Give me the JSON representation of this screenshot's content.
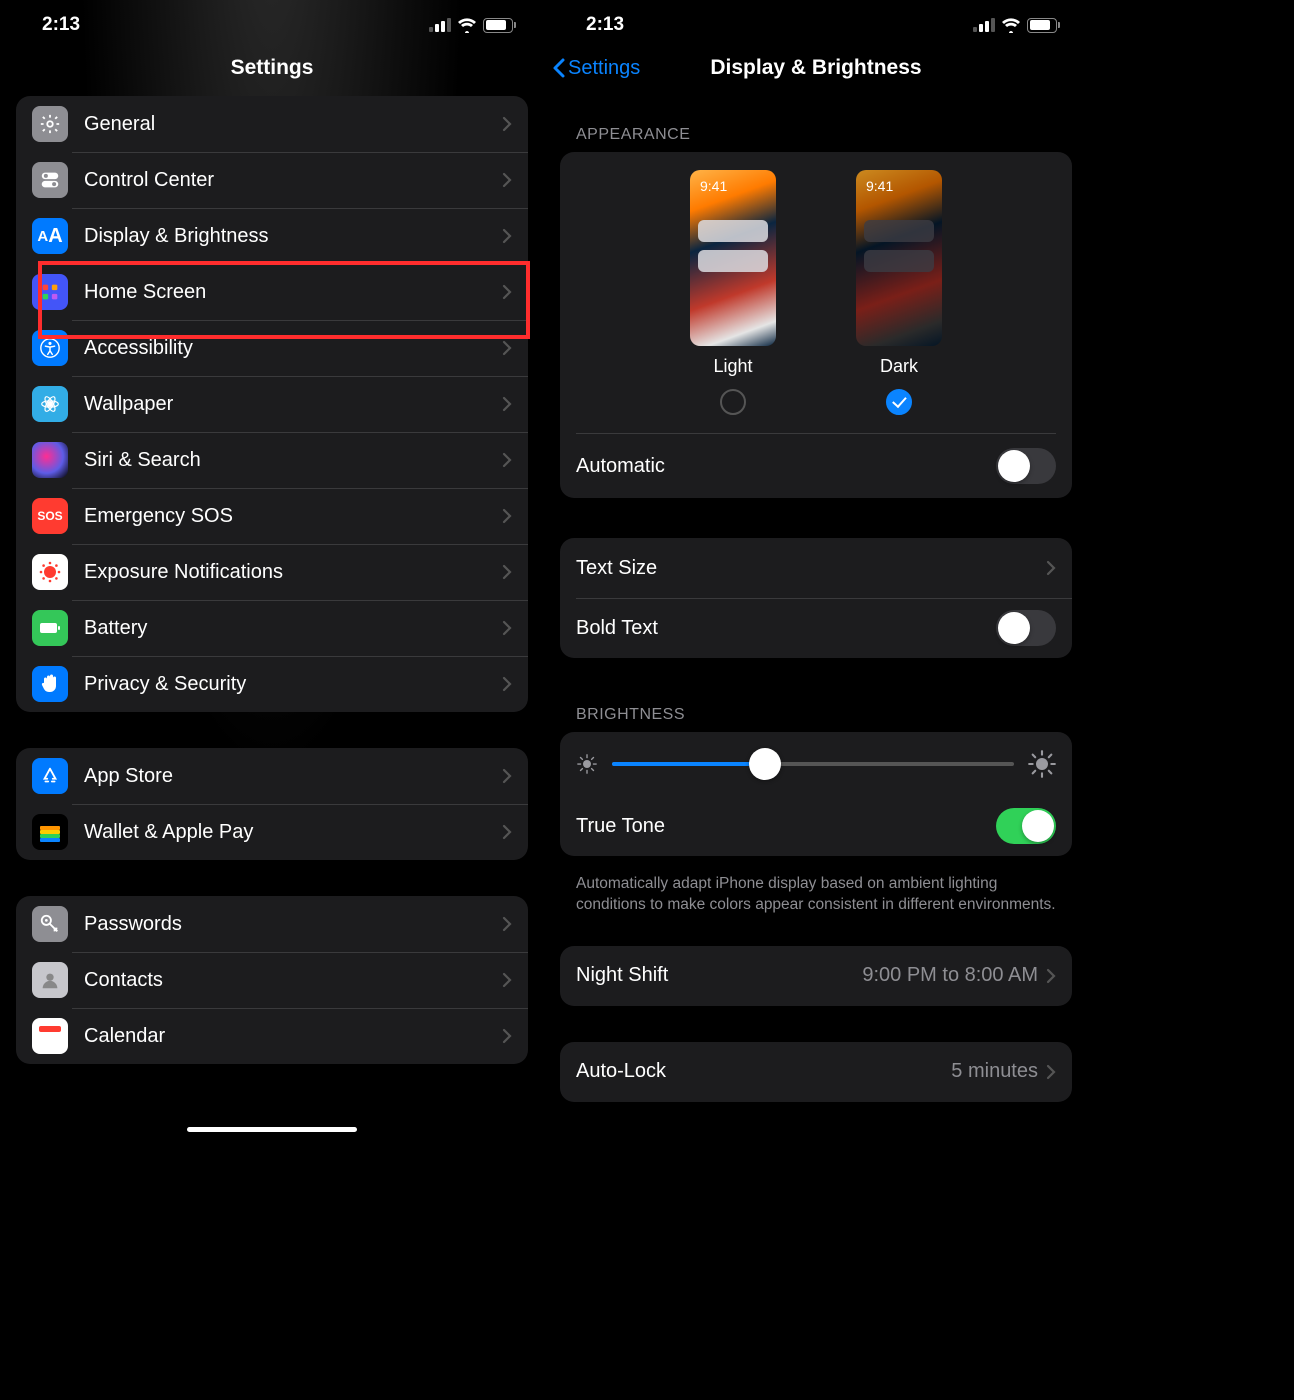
{
  "status": {
    "time": "2:13"
  },
  "left": {
    "title": "Settings",
    "group1": [
      {
        "label": "General"
      },
      {
        "label": "Control Center"
      },
      {
        "label": "Display & Brightness"
      },
      {
        "label": "Home Screen"
      },
      {
        "label": "Accessibility"
      },
      {
        "label": "Wallpaper"
      },
      {
        "label": "Siri & Search"
      },
      {
        "label": "Emergency SOS"
      },
      {
        "label": "Exposure Notifications"
      },
      {
        "label": "Battery"
      },
      {
        "label": "Privacy & Security"
      }
    ],
    "group2": [
      {
        "label": "App Store"
      },
      {
        "label": "Wallet & Apple Pay"
      }
    ],
    "group3": [
      {
        "label": "Passwords"
      },
      {
        "label": "Contacts"
      },
      {
        "label": "Calendar"
      }
    ]
  },
  "right": {
    "back": "Settings",
    "title": "Display & Brightness",
    "appearance": {
      "header": "APPEARANCE",
      "light": "Light",
      "dark": "Dark",
      "thumb_time": "9:41",
      "selected": "dark",
      "automatic_label": "Automatic",
      "automatic_on": false
    },
    "text": {
      "text_size": "Text Size",
      "bold_text": "Bold Text",
      "bold_on": false
    },
    "brightness": {
      "header": "BRIGHTNESS",
      "value_percent": 38,
      "true_tone": "True Tone",
      "true_tone_on": true,
      "description": "Automatically adapt iPhone display based on ambient lighting conditions to make colors appear consistent in different environments."
    },
    "night_shift": {
      "label": "Night Shift",
      "value": "9:00 PM to 8:00 AM"
    },
    "auto_lock": {
      "label": "Auto-Lock",
      "value": "5 minutes"
    }
  }
}
